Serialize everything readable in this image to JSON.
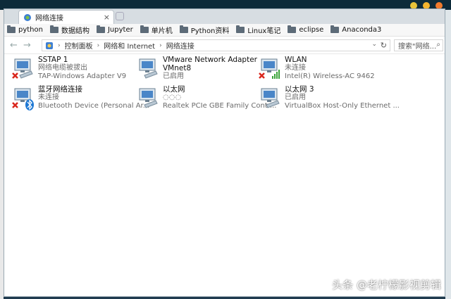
{
  "tab": {
    "title": "网络连接"
  },
  "bookmarks": [
    {
      "label": "python"
    },
    {
      "label": "数据结构"
    },
    {
      "label": "Jupyter"
    },
    {
      "label": "单片机"
    },
    {
      "label": "Python资料"
    },
    {
      "label": "Linux笔记"
    },
    {
      "label": "eclipse"
    },
    {
      "label": "Anaconda3"
    }
  ],
  "address": {
    "crumb1": "控制面板",
    "crumb2": "网络和 Internet",
    "crumb3": "网络连接"
  },
  "search": {
    "placeholder": "搜索\"网络..."
  },
  "adapters": [
    {
      "name": "SSTAP 1",
      "status": "网络电缆被拔出",
      "device": "TAP-Windows Adapter V9"
    },
    {
      "name": "VMware Network Adapter VMnet8",
      "name_line2": "VMnet8",
      "name_line1": "VMware Network Adapter",
      "status": "已启用",
      "device": ""
    },
    {
      "name": "WLAN",
      "status": "未连接",
      "device": "Intel(R) Wireless-AC 9462"
    },
    {
      "name": "蓝牙网络连接",
      "status": "未连接",
      "device": "Bluetooth Device (Personal Ar..."
    },
    {
      "name": "以太网",
      "status": "◌◌◌",
      "device": "Realtek PCIe GBE Family Contr..."
    },
    {
      "name": "以太网 3",
      "status": "已启用",
      "device": "VirtualBox Host-Only Ethernet ..."
    }
  ],
  "watermark": {
    "text": "头条 @老柠檬影视剪辑"
  },
  "colors": {
    "dot_yellow": "#f3b42f",
    "dot_orange": "#f07a2d",
    "dot_yellow2": "#e8c33a"
  }
}
